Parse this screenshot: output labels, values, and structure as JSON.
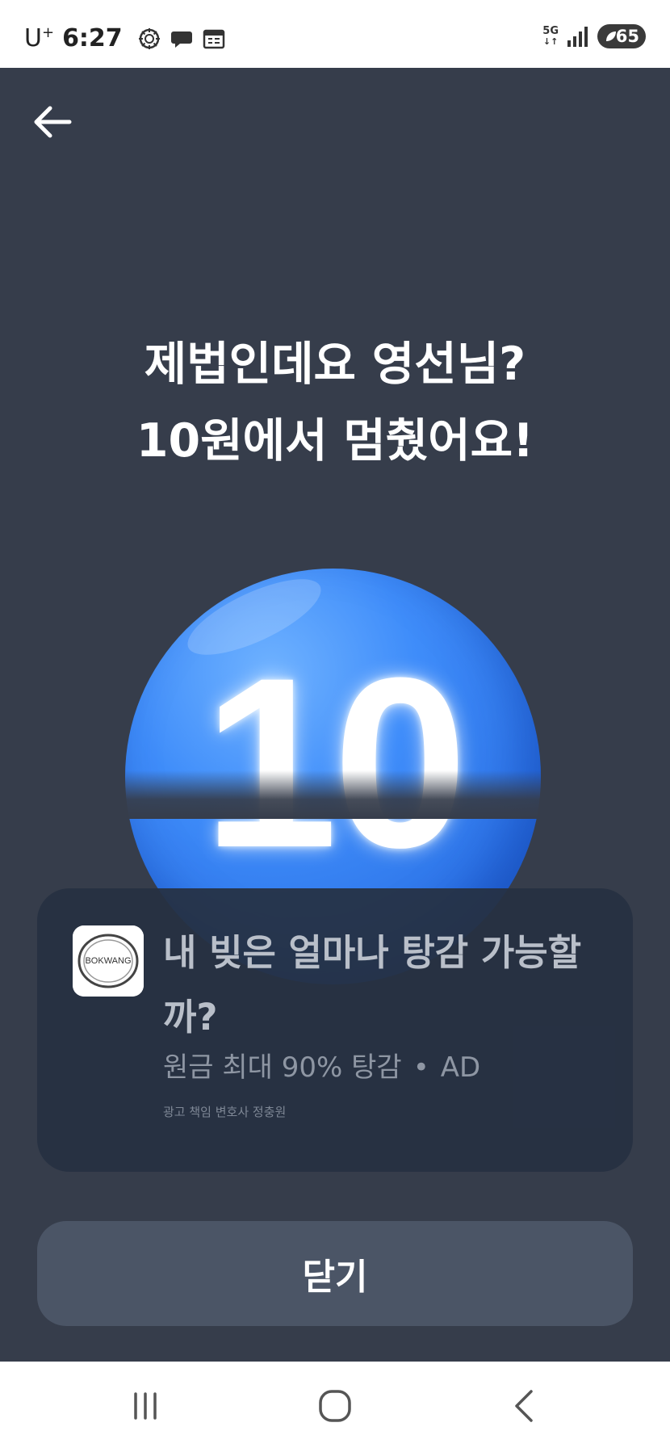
{
  "status_bar": {
    "carrier": "U",
    "carrier_sup": "+",
    "time": "6:27",
    "network": "5G",
    "battery": "65"
  },
  "header": {
    "back_icon": "arrow-left-icon"
  },
  "headline": {
    "line1": "제법인데요 영선님?",
    "line2": "10원에서 멈췄어요!"
  },
  "ball": {
    "number": "10",
    "color": "#3f8dfa"
  },
  "ad": {
    "logo_text": "BOKWANG",
    "title": "내 빚은 얼마나 탕감 가능할까?",
    "subtitle": "원금 최대 90% 탕감",
    "badge": "AD",
    "note": "광고 책임 변호사 정충원"
  },
  "actions": {
    "close_label": "닫기"
  },
  "nav_bar": {
    "icons": [
      "recent-apps-icon",
      "home-icon",
      "back-icon"
    ]
  },
  "colors": {
    "background": "#363d4b",
    "card": "#263042",
    "button": "#4b5566"
  }
}
